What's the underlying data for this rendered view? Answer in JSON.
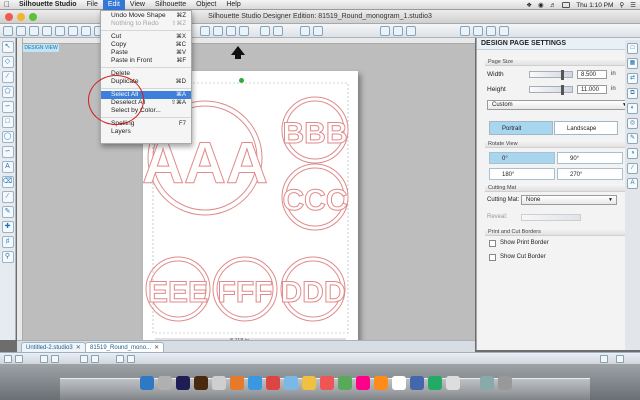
{
  "menubar": {
    "app_name": "Silhouette Studio",
    "items": [
      "File",
      "Edit",
      "View",
      "Silhouette",
      "Object",
      "Help"
    ],
    "active_item": "Edit",
    "clock": "Thu 1:10 PM"
  },
  "window": {
    "title": "Silhouette Studio Designer Edition: 81519_Round_monogram_1.studio3"
  },
  "edit_menu": {
    "items": [
      {
        "label": "Undo Move Shape",
        "shortcut": "⌘Z",
        "disabled": false
      },
      {
        "label": "Nothing to Redo",
        "shortcut": "⇧⌘Z",
        "disabled": true
      },
      {
        "label": "Cut",
        "shortcut": "⌘X",
        "disabled": false
      },
      {
        "label": "Copy",
        "shortcut": "⌘C",
        "disabled": false
      },
      {
        "label": "Paste",
        "shortcut": "⌘V",
        "disabled": false
      },
      {
        "label": "Paste in Front",
        "shortcut": "⌘F",
        "disabled": false
      },
      {
        "label": "Delete",
        "shortcut": "",
        "disabled": false
      },
      {
        "label": "Duplicate",
        "shortcut": "⌘D",
        "disabled": false
      },
      {
        "label": "Select All",
        "shortcut": "⌘A",
        "disabled": false,
        "selected": true
      },
      {
        "label": "Deselect All",
        "shortcut": "⇧⌘A",
        "disabled": false
      },
      {
        "label": "Select by Color...",
        "shortcut": "",
        "disabled": false
      },
      {
        "label": "Spelling",
        "shortcut": "F7",
        "disabled": false
      },
      {
        "label": "Layers",
        "shortcut": "",
        "disabled": false
      }
    ]
  },
  "canvas": {
    "view_tag": "DESIGN VIEW",
    "width_label": "8.118 in",
    "monograms": [
      "AAA",
      "BBB",
      "CCC",
      "EEE",
      "FFF",
      "DDD"
    ],
    "stroke_color": "#e08a8a"
  },
  "design_page_settings": {
    "title": "DESIGN PAGE SETTINGS",
    "page_size_section": "Page Size",
    "width_label": "Width",
    "width_value": "8.500",
    "height_label": "Height",
    "height_value": "11.000",
    "unit": "in",
    "size_preset": "Custom",
    "orientation_portrait": "Portrait",
    "orientation_landscape": "Landscape",
    "rotate_view_section": "Rotate View",
    "rotations": [
      "0°",
      "90°",
      "180°",
      "270°"
    ],
    "cutting_mat_section": "Cutting Mat",
    "cutting_mat_label": "Cutting Mat:",
    "cutting_mat_value": "None",
    "reveal_label": "Reveal:",
    "print_cut_section": "Print and Cut Borders",
    "show_print_border": "Show Print Border",
    "show_cut_border": "Show Cut Border"
  },
  "doc_tabs": [
    {
      "label": "Untitled-2.studio3"
    },
    {
      "label": "81519_Round_mono..."
    }
  ],
  "colors": {
    "accent": "#3e7fd9",
    "selected_toggle": "#a9d6ef",
    "annotation": "#d02020"
  }
}
